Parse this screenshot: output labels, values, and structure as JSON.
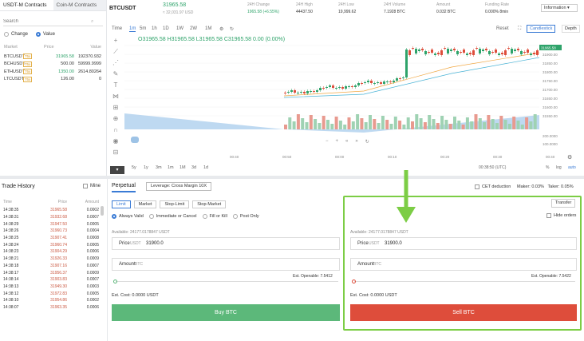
{
  "sidebar": {
    "tabs": [
      "USDT-M Contracts",
      "Coin-M Contracts"
    ],
    "search_placeholder": "Search",
    "radios": [
      "Change",
      "Value"
    ],
    "headers": [
      "Market",
      "Price",
      "Value"
    ],
    "markets": [
      {
        "name": "BTCUSDT",
        "badge": "75x",
        "price": "31965.58",
        "value": "192370.932",
        "color": "#2ea36a"
      },
      {
        "name": "BCHUSDT",
        "badge": "75x",
        "price": "500.00",
        "value": "59999.9999",
        "color": "#333333"
      },
      {
        "name": "ETHUSDT",
        "badge": "75x",
        "price": "1350.00",
        "value": "2614.80264",
        "color": "#2ea36a"
      },
      {
        "name": "LTCUSDT",
        "badge": "75x",
        "price": "126.00",
        "value": "0",
        "color": "#333333"
      }
    ]
  },
  "header": {
    "symbol": "BTCUSDT",
    "price": "31965.58",
    "price_sub": "≈ 32,031.97 USD",
    "stats": [
      {
        "label": "24H Change",
        "value": "1965.58 (+6.55%)",
        "color": "#2ea36a"
      },
      {
        "label": "24H High",
        "value": "44437.50",
        "color": "#333333"
      },
      {
        "label": "24H Low",
        "value": "19,999.62",
        "color": "#333333"
      },
      {
        "label": "24H Volume",
        "value": "7.1928 BTC",
        "color": "#333333"
      },
      {
        "label": "Amount",
        "value": "0.032 BTC",
        "color": "#333333"
      },
      {
        "label": "Funding Rate",
        "value": "0.000% 8min",
        "color": "#333333"
      }
    ],
    "info_btn": "Information ▾"
  },
  "chart_toolbar": {
    "time": "Time",
    "intervals": [
      "1m",
      "5m",
      "1h",
      "1D",
      "1W",
      "2W",
      "1M"
    ],
    "reset": "Reset",
    "candlestick": "Candlestick",
    "depth": "Depth"
  },
  "ohlc": "O31965.58 H31965.58 L31965.58 C31965.58 0.00 (0.00%)",
  "chart_data": {
    "type": "candlestick",
    "y_ticks": [
      "31950.00",
      "31900.00",
      "31850.00",
      "31800.00",
      "31750.00",
      "31700.00",
      "31650.00",
      "31600.00",
      "31550.00"
    ],
    "last_price_label": "31965.58",
    "volume_ticks": [
      "200.0000",
      "100.0000"
    ],
    "x_ticks": [
      "00:40",
      "00:50",
      "00:00",
      "00:10",
      "00:20",
      "00:30",
      "00:40"
    ],
    "ranges": [
      "5y",
      "1y",
      "3m",
      "1m",
      "1M",
      "3d",
      "1d"
    ],
    "clock": "00:38:50 (UTC)",
    "scale_opts": [
      "%",
      "log",
      "auto"
    ]
  },
  "trade_history": {
    "title": "Trade History",
    "mine": "Mine",
    "headers": [
      "Time",
      "Price",
      "Amount"
    ],
    "rows": [
      [
        "14:38:35",
        "31965.58",
        "0.0002"
      ],
      [
        "14:38:31",
        "31932.68",
        "0.0007"
      ],
      [
        "14:38:29",
        "31947.50",
        "0.0005"
      ],
      [
        "14:38:26",
        "31960.73",
        "0.0004"
      ],
      [
        "14:38:25",
        "31907.41",
        "0.0008"
      ],
      [
        "14:38:24",
        "31960.74",
        "0.0005"
      ],
      [
        "14:38:23",
        "31904.29",
        "0.0006"
      ],
      [
        "14:38:21",
        "31926.33",
        "0.0009"
      ],
      [
        "14:38:18",
        "31907.16",
        "0.0007"
      ],
      [
        "14:38:17",
        "31956.37",
        "0.0009"
      ],
      [
        "14:38:14",
        "31903.83",
        "0.0007"
      ],
      [
        "14:38:13",
        "31949.30",
        "0.0003"
      ],
      [
        "14:38:12",
        "31972.83",
        "0.0005"
      ],
      [
        "14:38:10",
        "31954.86",
        "0.0002"
      ],
      [
        "14:38:07",
        "31963.35",
        "0.0006"
      ]
    ]
  },
  "order": {
    "perpetual": "Perpetual",
    "leverage": "Leverage: Cross Margin 10X",
    "cet": "CET deduction",
    "maker": "Maker: 0.03%",
    "taker": "Taker: 0.05%",
    "types": [
      "Limit",
      "Market",
      "Stop-Limit",
      "Stop-Market"
    ],
    "options": [
      "Always Valid",
      "Immediate or Cancel",
      "Fill or Kill",
      "Post Only"
    ],
    "transfer": "Transfer",
    "hide_orders": "Hide orders",
    "buy": {
      "available": "Available: 24177.0178847 USDT",
      "price_label": "Price",
      "price_unit": "USDT",
      "price_value": "31900.0",
      "amount_label": "Amount",
      "amount_unit": "BTC",
      "openable": "Est. Openable: 7.5412",
      "cost": "Est. Cost: 0.0000 USDT",
      "button": "Buy BTC",
      "color": "#5cb87a"
    },
    "sell": {
      "available": "Available: 24177.0178847 USDT",
      "price_label": "Price",
      "price_unit": "USDT",
      "price_value": "31900.0",
      "amount_label": "Amount",
      "amount_unit": "BTC",
      "openable": "Est. Openable: 7.5422",
      "cost": "Est. Cost: 0.0000 USDT",
      "button": "Sell BTC",
      "color": "#de4d3b"
    }
  }
}
